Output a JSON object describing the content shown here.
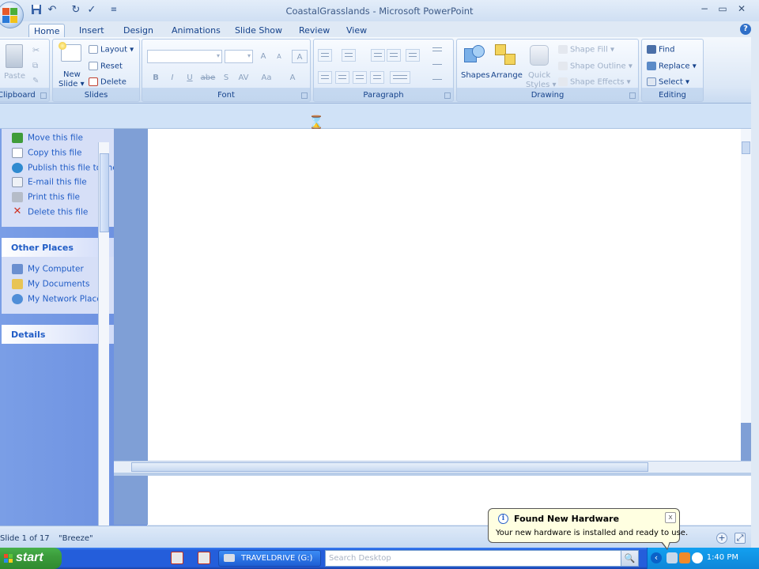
{
  "window": {
    "title": "CoastalGrasslands - Microsoft PowerPoint",
    "min": "−",
    "max": "▭",
    "close": "✕"
  },
  "qat": {
    "undo_icon": "↶",
    "redo_icon": "↻",
    "check_icon": "✓",
    "menu_icon": "≡"
  },
  "tabs": [
    "Home",
    "Insert",
    "Design",
    "Animations",
    "Slide Show",
    "Review",
    "View"
  ],
  "help_label": "?",
  "ribbon": {
    "clipboard": {
      "label": "Clipboard",
      "paste": "Paste"
    },
    "slides": {
      "label": "Slides",
      "new_slide_line1": "New",
      "new_slide_line2": "Slide ▾",
      "layout": "Layout ▾",
      "reset": "Reset",
      "delete": "Delete"
    },
    "font": {
      "label": "Font",
      "bold": "B",
      "italic": "I",
      "underline": "U",
      "strike": "abe",
      "shadow": "S",
      "spacing": "AV",
      "case": "Aa",
      "color": "A",
      "grow": "A",
      "shrink": "A",
      "clear": "A"
    },
    "paragraph": {
      "label": "Paragraph"
    },
    "drawing": {
      "label": "Drawing",
      "shapes": "Shapes",
      "arrange": "Arrange",
      "quick_line1": "Quick",
      "quick_line2": "Styles ▾",
      "shape_fill": "Shape Fill ▾",
      "shape_outline": "Shape Outline ▾",
      "shape_effects": "Shape Effects ▾"
    },
    "editing": {
      "label": "Editing",
      "find": "Find",
      "replace": "Replace ▾",
      "select": "Select ▾"
    }
  },
  "hourglass": "⌛",
  "taskpane": {
    "file_tasks": [
      {
        "label": "Move this file",
        "color": "#3f9c3a"
      },
      {
        "label": "Copy this file",
        "color": "#d6dde8"
      },
      {
        "label": "Publish this file to the Web",
        "color": "#2f8ad0"
      },
      {
        "label": "E-mail this file",
        "color": "#c6cdd8"
      },
      {
        "label": "Print this file",
        "color": "#b5bcc8"
      },
      {
        "label": "Delete this file",
        "color": "#d03020"
      }
    ],
    "other_places": {
      "title": "Other Places",
      "chevron": "⌃",
      "items": [
        {
          "label": "My Computer",
          "color": "#6a8fd0"
        },
        {
          "label": "My Documents",
          "color": "#e8c454"
        },
        {
          "label": "My Network Places",
          "color": "#4f8ed8"
        }
      ]
    },
    "details": {
      "title": "Details",
      "chevron": "⌄"
    }
  },
  "status": {
    "slide": "Slide 1 of 17",
    "theme": "\"Breeze\"",
    "zoom_in": "+",
    "fit": "⤢"
  },
  "balloon": {
    "title": "Found New Hardware",
    "body": "Your new hardware is installed and ready to use.",
    "icon": "i",
    "close": "x"
  },
  "taskbar": {
    "start": "start",
    "task": "TRAVELDRIVE (G:)",
    "search_placeholder": "Search Desktop",
    "search_icon": "🔍",
    "tray_arrow": "‹",
    "clock": "1:40 PM"
  },
  "colors": {
    "accent": "#15428b",
    "taskbar": "#245edb",
    "start": "#3c9c3c"
  }
}
